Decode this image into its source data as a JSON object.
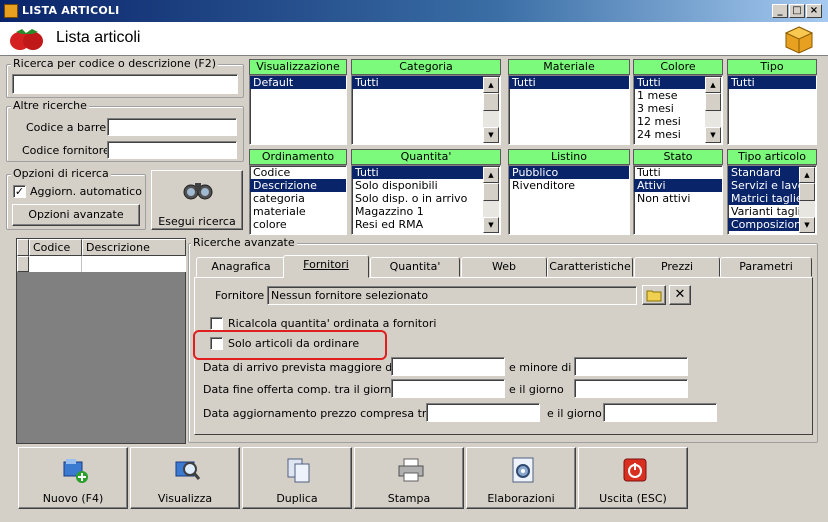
{
  "window": {
    "title": "LISTA ARTICOLI",
    "header_title": "Lista articoli"
  },
  "search": {
    "group_label": "Ricerca per codice o descrizione (F2)",
    "value": "",
    "other_label": "Altre ricerche",
    "barcode_label": "Codice a barre :",
    "supplier_code_label": "Codice fornitore :"
  },
  "options": {
    "group_label": "Opzioni di ricerca",
    "auto_update_label": "Aggiorn. automatico",
    "auto_update_checked": "✓",
    "advanced_button": "Opzioni avanzate",
    "search_button": "Esegui ricerca"
  },
  "filters": [
    {
      "header": "Visualizzazione",
      "items": [
        "Default"
      ],
      "selected": [
        0
      ],
      "scroll": false
    },
    {
      "header": "Categoria",
      "items": [
        "Tutti"
      ],
      "selected": [
        0
      ],
      "scroll": true
    },
    {
      "header": "Materiale",
      "items": [
        "Tutti"
      ],
      "selected": [
        0
      ],
      "scroll": false
    },
    {
      "header": "Colore",
      "items": [
        "Tutti",
        "1 mese",
        "3 mesi",
        "12 mesi",
        "24 mesi"
      ],
      "selected": [
        0
      ],
      "scroll": true
    },
    {
      "header": "Tipo",
      "items": [
        "Tutti"
      ],
      "selected": [
        0
      ],
      "scroll": false
    },
    {
      "header": "Ordinamento",
      "items": [
        "Codice",
        "Descrizione",
        "categoria",
        "materiale",
        "colore"
      ],
      "selected": [
        1
      ],
      "scroll": false
    },
    {
      "header": "Quantita'",
      "items": [
        "Tutti",
        "Solo disponibili",
        "Solo disp. o in arrivo",
        "Magazzino 1",
        "Resi ed RMA"
      ],
      "selected": [
        0
      ],
      "scroll": true
    },
    {
      "header": "Listino",
      "items": [
        "Pubblico",
        "Rivenditore"
      ],
      "selected": [
        0
      ],
      "scroll": false
    },
    {
      "header": "Stato",
      "items": [
        "Tutti",
        "Attivi",
        "Non attivi"
      ],
      "selected": [
        1
      ],
      "scroll": false
    },
    {
      "header": "Tipo articolo",
      "items": [
        "Standard",
        "Servizi e lavora",
        "Matrici taglie",
        "Varianti taglie",
        "Composizioni"
      ],
      "selected": [
        0,
        1,
        2,
        4
      ],
      "scroll": true
    }
  ],
  "grid": {
    "columns": [
      "Codice",
      "Descrizione"
    ]
  },
  "advanced": {
    "group_label": "Ricerche avanzate",
    "tabs": [
      "Anagrafica",
      "Fornitori",
      "Quantita'",
      "Web",
      "Caratteristiche",
      "Prezzi",
      "Parametri"
    ],
    "active_tab": "Fornitori",
    "supplier_label": "Fornitore :",
    "supplier_value": "Nessun fornitore selezionato",
    "recalc_label": "Ricalcola quantita' ordinata a fornitori",
    "only_to_order_label": "Solo articoli da ordinare",
    "arrival_label": "Data di arrivo prevista maggiore di",
    "arrival_less_label": "e minore di",
    "offer_label": "Data fine offerta comp. tra il giorno",
    "offer_and_label": "e il giorno",
    "price_update_label": "Data aggiornamento prezzo compresa tra",
    "price_and_label": "e il giorno"
  },
  "toolbar": {
    "new": "Nuovo (F4)",
    "view": "Visualizza",
    "duplicate": "Duplica",
    "print": "Stampa",
    "processing": "Elaborazioni",
    "exit": "Uscita (ESC)"
  },
  "colors": {
    "filter_header": "#7cfa7c",
    "selection": "#0a246a",
    "highlight": "#e02020"
  }
}
